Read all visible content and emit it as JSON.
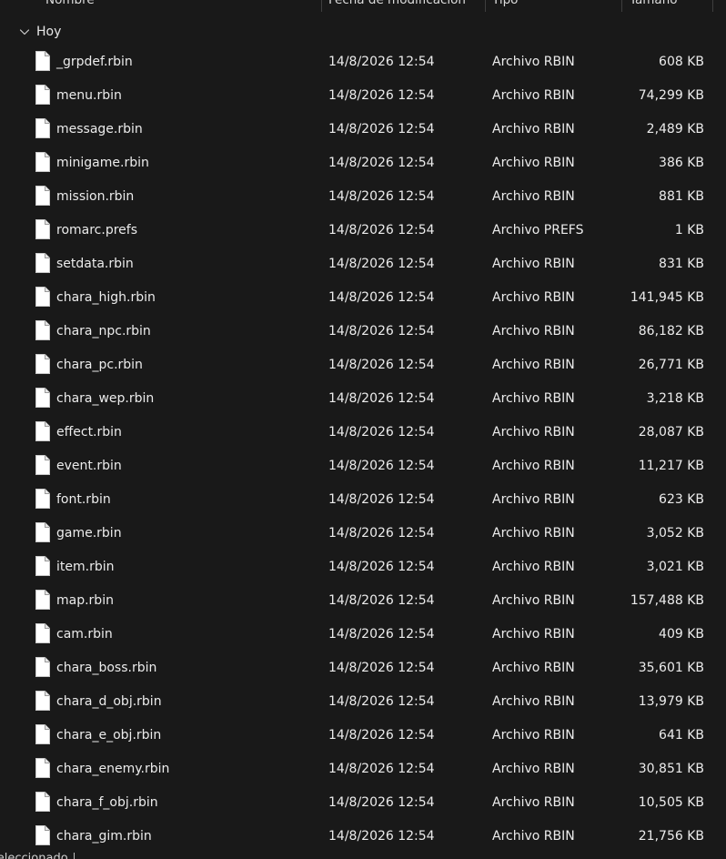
{
  "columns": {
    "name": "Nombre",
    "date": "Fecha de modificación",
    "type": "Tipo",
    "size": "Tamaño"
  },
  "group": {
    "label": "Hoy"
  },
  "files": [
    {
      "name": "_grpdef.rbin",
      "date": "14/8/2026 12:54",
      "type": "Archivo RBIN",
      "size": "608 KB"
    },
    {
      "name": "menu.rbin",
      "date": "14/8/2026 12:54",
      "type": "Archivo RBIN",
      "size": "74,299 KB"
    },
    {
      "name": "message.rbin",
      "date": "14/8/2026 12:54",
      "type": "Archivo RBIN",
      "size": "2,489 KB"
    },
    {
      "name": "minigame.rbin",
      "date": "14/8/2026 12:54",
      "type": "Archivo RBIN",
      "size": "386 KB"
    },
    {
      "name": "mission.rbin",
      "date": "14/8/2026 12:54",
      "type": "Archivo RBIN",
      "size": "881 KB"
    },
    {
      "name": "romarc.prefs",
      "date": "14/8/2026 12:54",
      "type": "Archivo PREFS",
      "size": "1 KB"
    },
    {
      "name": "setdata.rbin",
      "date": "14/8/2026 12:54",
      "type": "Archivo RBIN",
      "size": "831 KB"
    },
    {
      "name": "chara_high.rbin",
      "date": "14/8/2026 12:54",
      "type": "Archivo RBIN",
      "size": "141,945 KB"
    },
    {
      "name": "chara_npc.rbin",
      "date": "14/8/2026 12:54",
      "type": "Archivo RBIN",
      "size": "86,182 KB"
    },
    {
      "name": "chara_pc.rbin",
      "date": "14/8/2026 12:54",
      "type": "Archivo RBIN",
      "size": "26,771 KB"
    },
    {
      "name": "chara_wep.rbin",
      "date": "14/8/2026 12:54",
      "type": "Archivo RBIN",
      "size": "3,218 KB"
    },
    {
      "name": "effect.rbin",
      "date": "14/8/2026 12:54",
      "type": "Archivo RBIN",
      "size": "28,087 KB"
    },
    {
      "name": "event.rbin",
      "date": "14/8/2026 12:54",
      "type": "Archivo RBIN",
      "size": "11,217 KB"
    },
    {
      "name": "font.rbin",
      "date": "14/8/2026 12:54",
      "type": "Archivo RBIN",
      "size": "623 KB"
    },
    {
      "name": "game.rbin",
      "date": "14/8/2026 12:54",
      "type": "Archivo RBIN",
      "size": "3,052 KB"
    },
    {
      "name": "item.rbin",
      "date": "14/8/2026 12:54",
      "type": "Archivo RBIN",
      "size": "3,021 KB"
    },
    {
      "name": "map.rbin",
      "date": "14/8/2026 12:54",
      "type": "Archivo RBIN",
      "size": "157,488 KB"
    },
    {
      "name": "cam.rbin",
      "date": "14/8/2026 12:54",
      "type": "Archivo RBIN",
      "size": "409 KB"
    },
    {
      "name": "chara_boss.rbin",
      "date": "14/8/2026 12:54",
      "type": "Archivo RBIN",
      "size": "35,601 KB"
    },
    {
      "name": "chara_d_obj.rbin",
      "date": "14/8/2026 12:54",
      "type": "Archivo RBIN",
      "size": "13,979 KB"
    },
    {
      "name": "chara_e_obj.rbin",
      "date": "14/8/2026 12:54",
      "type": "Archivo RBIN",
      "size": "641 KB"
    },
    {
      "name": "chara_enemy.rbin",
      "date": "14/8/2026 12:54",
      "type": "Archivo RBIN",
      "size": "30,851 KB"
    },
    {
      "name": "chara_f_obj.rbin",
      "date": "14/8/2026 12:54",
      "type": "Archivo RBIN",
      "size": "10,505 KB"
    },
    {
      "name": "chara_gim.rbin",
      "date": "14/8/2026 12:54",
      "type": "Archivo RBIN",
      "size": "21,756 KB"
    }
  ],
  "statusbar": {
    "text": "seleccionado"
  },
  "icons": {
    "file": "file-icon",
    "group_toggle": "chevron-down-icon"
  },
  "colors": {
    "background": "#191919",
    "text": "#ececec",
    "separator": "#3e3e3e"
  }
}
